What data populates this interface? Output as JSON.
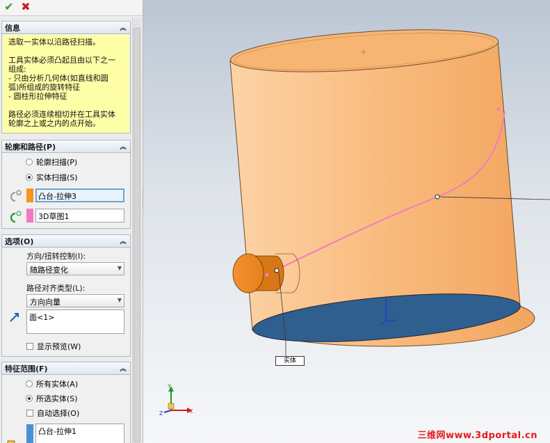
{
  "toolbar": {
    "ok": "✔",
    "cancel": "✖"
  },
  "info": {
    "title": "信息",
    "text1": "选取一实体以沿路径扫描。",
    "text2": "工具实体必须凸起且由以下之一\n组成:\n   - 只由分析几何体(如直线和圆\n弧)所组成的旋转特征\n   - 圆柱形拉伸特征",
    "text3": "路径必须连续相切并在工具实体\n轮廓之上或之内的点开始。"
  },
  "profile": {
    "title": "轮廓和路径(P)",
    "radio1": "轮廓扫描(P)",
    "radio2": "实体扫描(S)",
    "tool_body": "凸台-拉伸3",
    "path": "3D草图1",
    "tool_color": "#f7941d",
    "path_color": "#f07cc0"
  },
  "options": {
    "title": "选项(O)",
    "twist_label": "方向/扭转控制(I):",
    "twist_value": "随路径变化",
    "align_label": "路径对齐类型(L):",
    "align_value": "方向向量",
    "direction_value": "面<1>",
    "preview": "显示预览(W)"
  },
  "scope": {
    "title": "特征范围(F)",
    "radio1": "所有实体(A)",
    "radio2": "所选实体(S)",
    "auto": "自动选择(O)",
    "body": "凸台-拉伸1"
  },
  "viewport": {
    "callout": "实体",
    "watermark": "三维网www.3dportal.cn",
    "body_color": "#f9b97a",
    "bottom_color": "#2f5f8f",
    "axis_x": "X",
    "axis_y": "Y",
    "axis_z": "Z"
  }
}
